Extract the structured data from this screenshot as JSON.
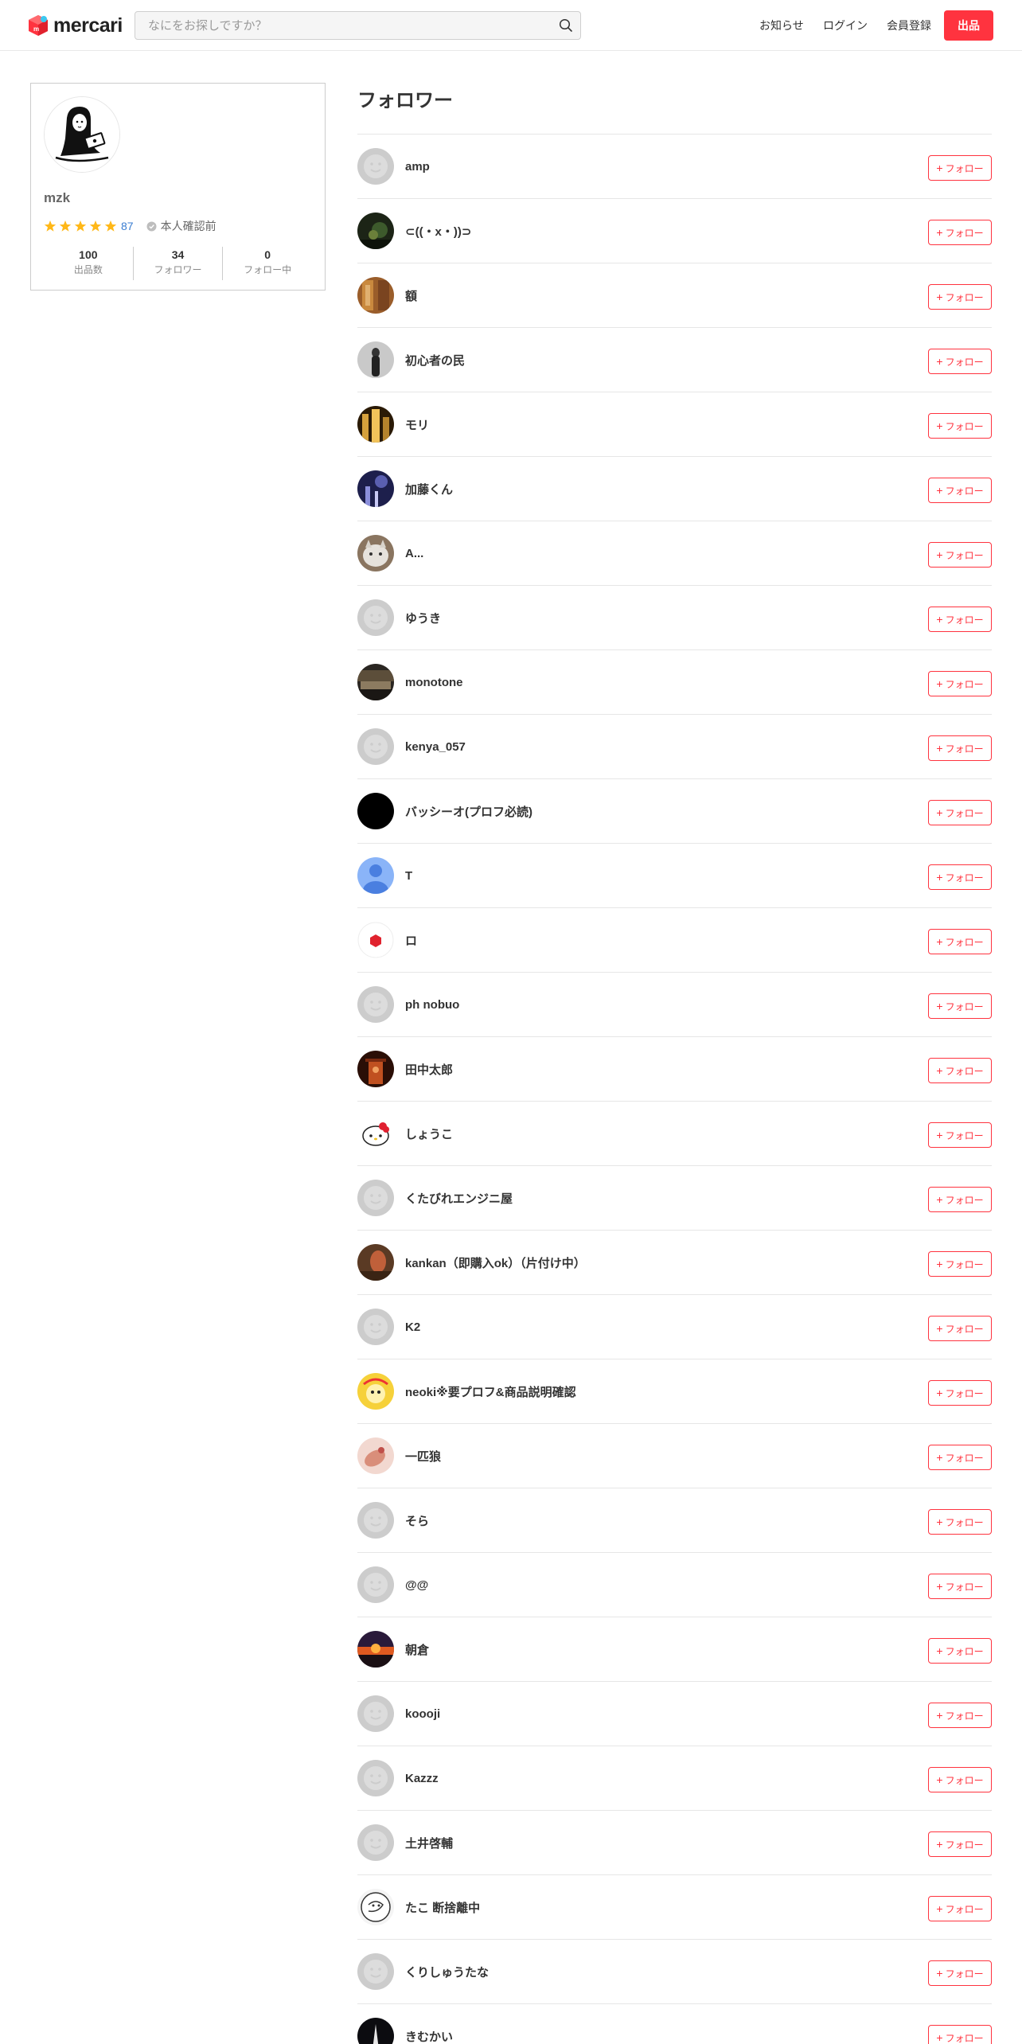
{
  "header": {
    "logo_text": "mercari",
    "search_placeholder": "なにをお探しですか？",
    "nav": {
      "notifications": "お知らせ",
      "login": "ログイン",
      "signup": "会員登録",
      "sell": "出品"
    }
  },
  "profile": {
    "name": "mzk",
    "rating_stars": 5,
    "rating_count": "87",
    "verification": "本人確認前",
    "stats": [
      {
        "value": "100",
        "label": "出品数"
      },
      {
        "value": "34",
        "label": "フォロワー"
      },
      {
        "value": "0",
        "label": "フォロー中"
      }
    ]
  },
  "page_title": "フォロワー",
  "follow_label": "フォロー",
  "colors": {
    "accent": "#ff333f",
    "link_blue": "#3a7dd1",
    "star": "#ffb818",
    "default_avatar": "#cccccc"
  },
  "followers": [
    {
      "name": "amp",
      "avatar": "default"
    },
    {
      "name": "⊂((・x・))⊃",
      "avatar": "photo-dark-green"
    },
    {
      "name": "額",
      "avatar": "photo-wood"
    },
    {
      "name": "初心者の民",
      "avatar": "photo-person-gray"
    },
    {
      "name": "モリ",
      "avatar": "photo-city-night"
    },
    {
      "name": "加藤くん",
      "avatar": "photo-night-blue"
    },
    {
      "name": "A...",
      "avatar": "photo-cat"
    },
    {
      "name": "ゆうき",
      "avatar": "default"
    },
    {
      "name": "monotone",
      "avatar": "photo-street"
    },
    {
      "name": "kenya_057",
      "avatar": "default"
    },
    {
      "name": "バッシーオ(プロフ必読)",
      "avatar": "black"
    },
    {
      "name": "T",
      "avatar": "blue-person"
    },
    {
      "name": "ロ",
      "avatar": "red-box"
    },
    {
      "name": "ph nobuo",
      "avatar": "default"
    },
    {
      "name": "田中太郎",
      "avatar": "photo-shrine"
    },
    {
      "name": "しょうこ",
      "avatar": "kitty"
    },
    {
      "name": "くたびれエンジニ屋",
      "avatar": "default"
    },
    {
      "name": "kankan（即購入ok）（片付け中）",
      "avatar": "photo-brown"
    },
    {
      "name": "K2",
      "avatar": "default"
    },
    {
      "name": "neoki※要プロフ&商品説明確認",
      "avatar": "yellow-char"
    },
    {
      "name": "一匹狼",
      "avatar": "photo-hand"
    },
    {
      "name": "そら",
      "avatar": "default"
    },
    {
      "name": "@@",
      "avatar": "default"
    },
    {
      "name": "朝倉",
      "avatar": "photo-sunset"
    },
    {
      "name": "koooji",
      "avatar": "default"
    },
    {
      "name": "Kazzz",
      "avatar": "default"
    },
    {
      "name": "土井啓輔",
      "avatar": "default"
    },
    {
      "name": "たこ 断捨離中",
      "avatar": "sketch"
    },
    {
      "name": "くりしゅうたな",
      "avatar": "default"
    },
    {
      "name": "きむかい",
      "avatar": "photo-tower"
    }
  ]
}
